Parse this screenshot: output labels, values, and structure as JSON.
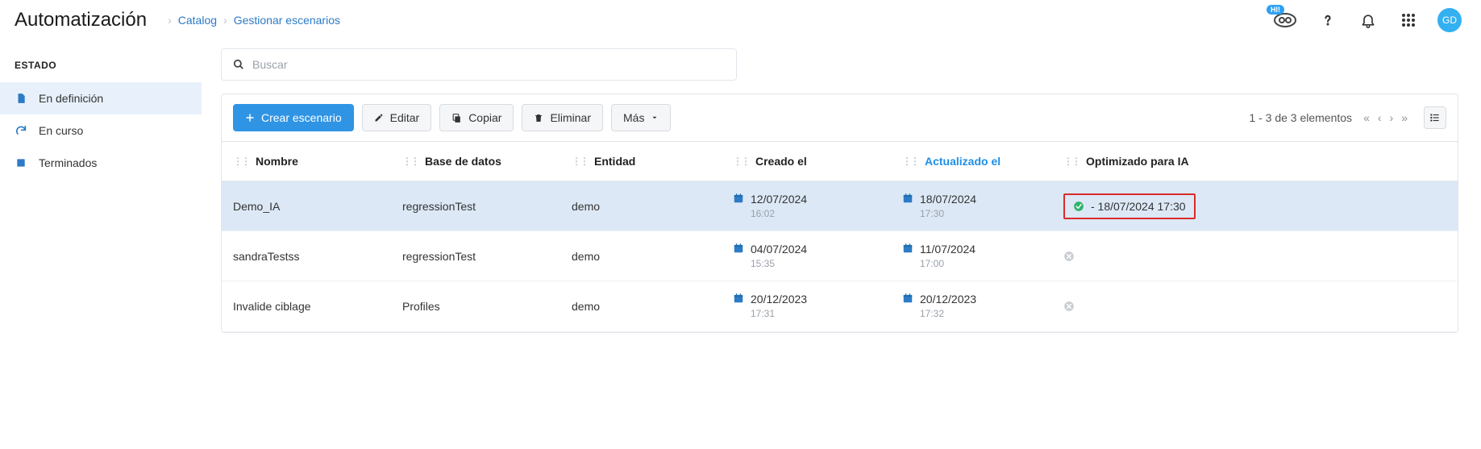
{
  "header": {
    "title": "Automatización",
    "breadcrumbs": [
      "Catalog",
      "Gestionar escenarios"
    ],
    "hi_badge": "HI!",
    "avatar_initials": "GD"
  },
  "sidebar": {
    "title": "ESTADO",
    "items": [
      {
        "label": "En definición",
        "selected": true,
        "icon": "doc"
      },
      {
        "label": "En curso",
        "selected": false,
        "icon": "refresh"
      },
      {
        "label": "Terminados",
        "selected": false,
        "icon": "square"
      }
    ]
  },
  "search": {
    "placeholder": "Buscar",
    "value": ""
  },
  "toolbar": {
    "create": "Crear escenario",
    "edit": "Editar",
    "copy": "Copiar",
    "delete": "Eliminar",
    "more": "Más",
    "pager_text": "1 - 3 de 3 elementos"
  },
  "columns": {
    "name": "Nombre",
    "db": "Base de datos",
    "entity": "Entidad",
    "created": "Creado el",
    "updated": "Actualizado el",
    "optimized": "Optimizado para IA",
    "sort": "updated"
  },
  "rows": [
    {
      "name": "Demo_IA",
      "db": "regressionTest",
      "entity": "demo",
      "created_date": "12/07/2024",
      "created_time": "16:02",
      "updated_date": "18/07/2024",
      "updated_time": "17:30",
      "optimized_ok": true,
      "optimized_text": "- 18/07/2024 17:30",
      "selected": true,
      "highlight": true
    },
    {
      "name": "sandraTestss",
      "db": "regressionTest",
      "entity": "demo",
      "created_date": "04/07/2024",
      "created_time": "15:35",
      "updated_date": "11/07/2024",
      "updated_time": "17:00",
      "optimized_ok": false,
      "optimized_text": "",
      "selected": false,
      "highlight": false
    },
    {
      "name": "Invalide ciblage",
      "db": "Profiles",
      "entity": "demo",
      "created_date": "20/12/2023",
      "created_time": "17:31",
      "updated_date": "20/12/2023",
      "updated_time": "17:32",
      "optimized_ok": false,
      "optimized_text": "",
      "selected": false,
      "highlight": false
    }
  ]
}
